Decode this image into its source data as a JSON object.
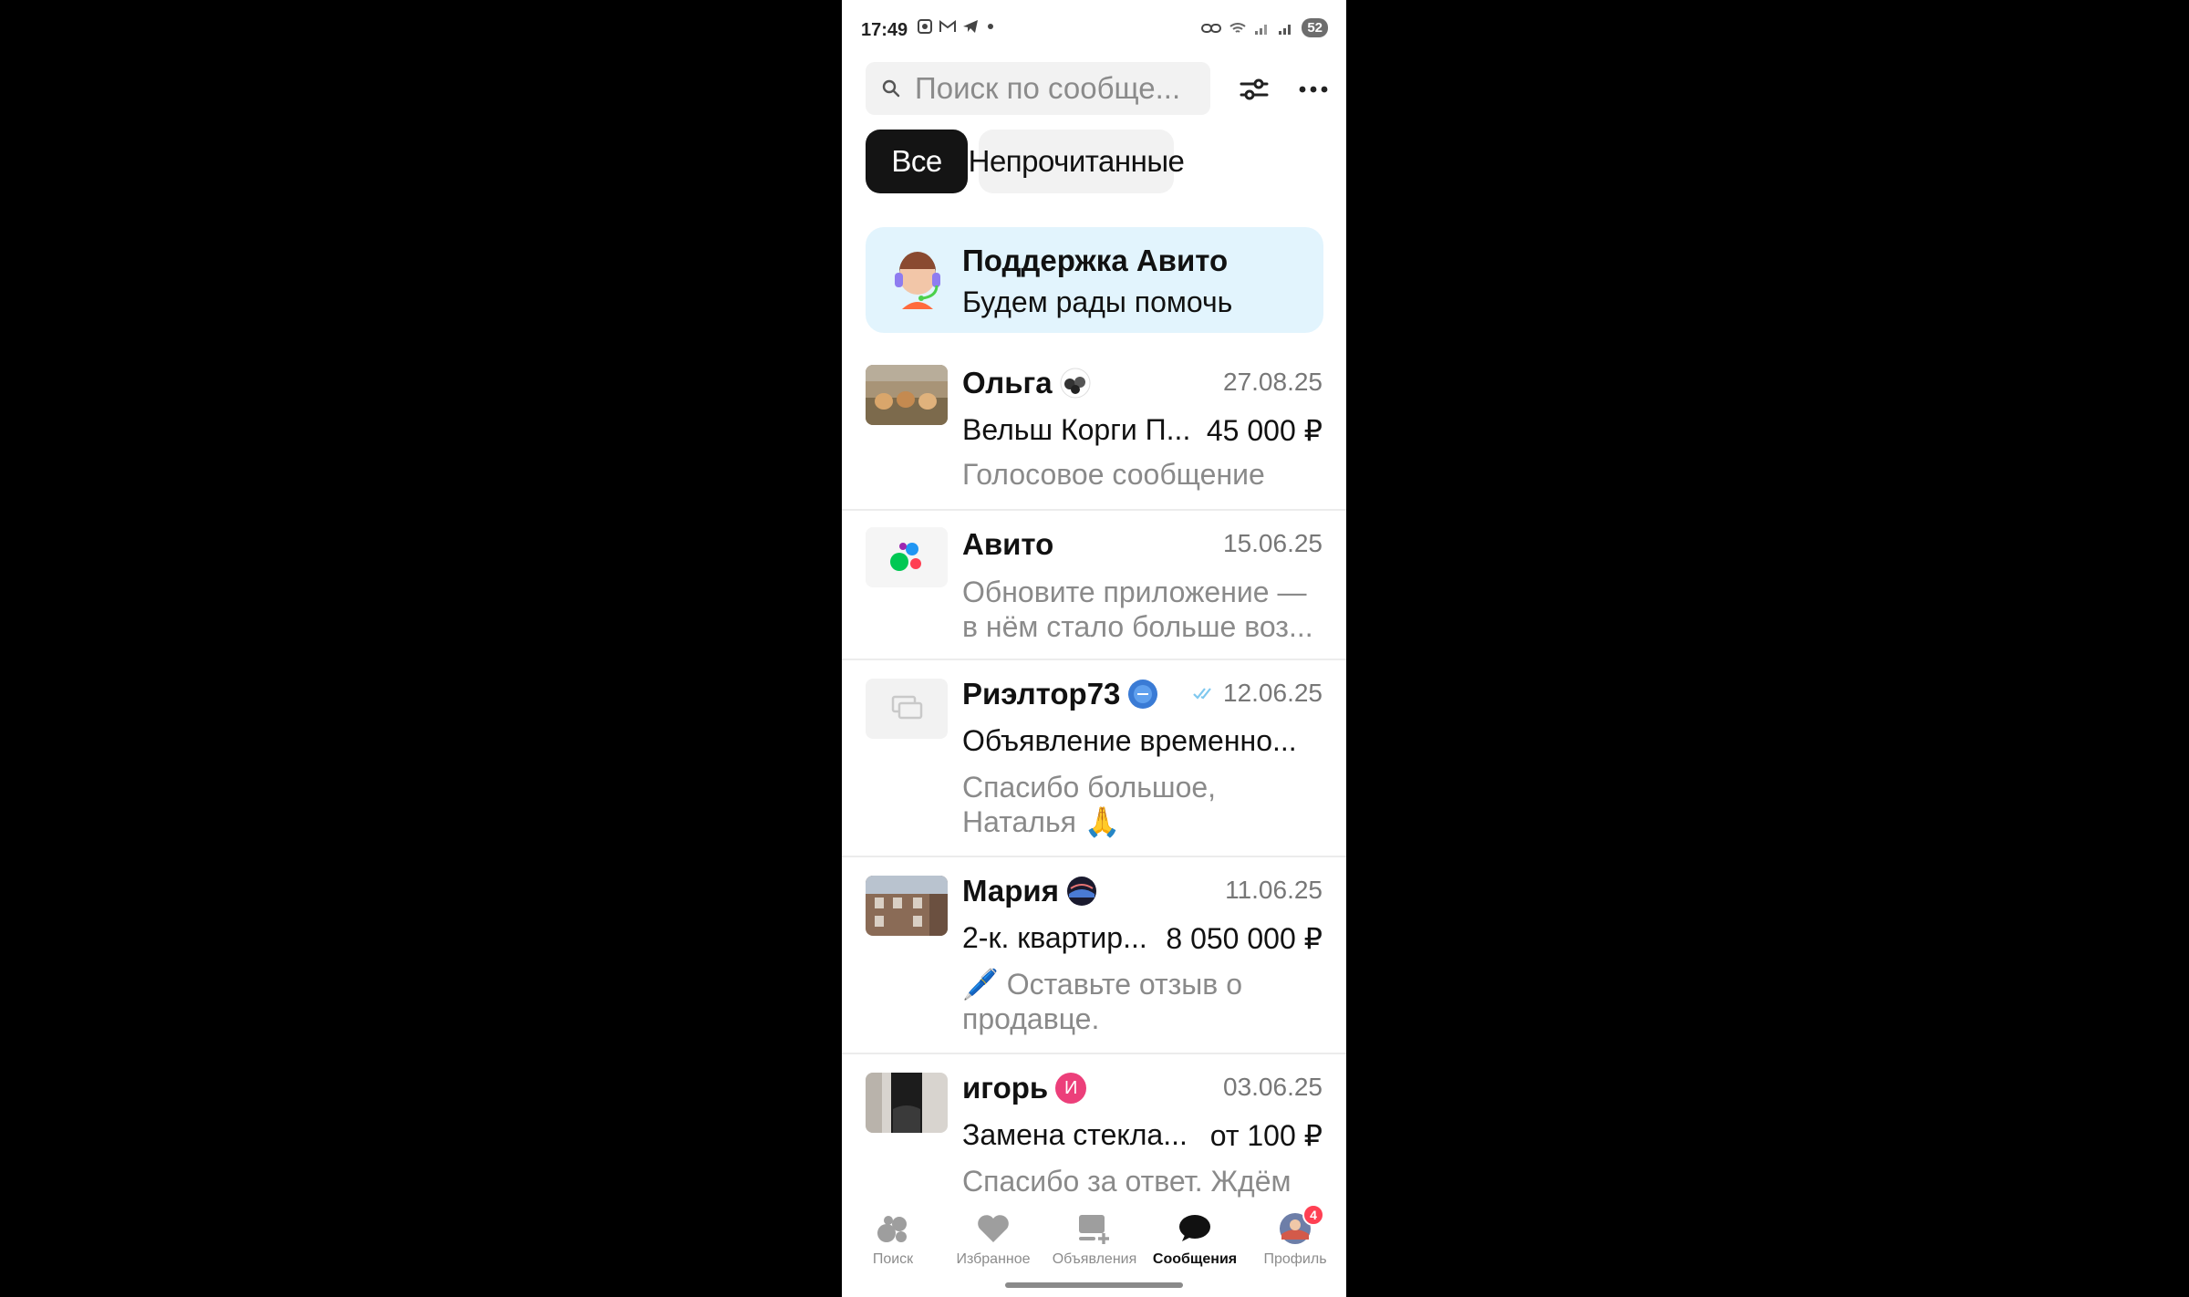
{
  "status_bar": {
    "time": "17:49",
    "battery": "52",
    "left_icons": [
      "screenshot-icon",
      "gmail-icon",
      "telegram-icon",
      "dot-icon"
    ],
    "right_icons": [
      "link-icon",
      "wifi-icon",
      "signal-icon",
      "signal-icon"
    ]
  },
  "search": {
    "placeholder": "Поиск по сообще..."
  },
  "toolbar": {
    "filter_icon": "sliders-icon",
    "more_icon": "more-dots-icon"
  },
  "chips": {
    "all": "Все",
    "unread": "Непрочитанные"
  },
  "support": {
    "title": "Поддержка Авито",
    "subtitle": "Будем рады помочь"
  },
  "chats": [
    {
      "name": "Ольга",
      "date": "27.08.25",
      "item": "Вельш Корги П...",
      "price": "45 000 ₽",
      "message": "Голосовое сообщение"
    },
    {
      "name": "Авито",
      "date": "15.06.25",
      "message": "Обновите приложение — в нём стало больше воз..."
    },
    {
      "name": "Риэлтор73",
      "date": "12.06.25",
      "item": "Объявление временно...",
      "message": "Спасибо большое, Наталья 🙏"
    },
    {
      "name": "Мария",
      "date": "11.06.25",
      "item": "2-к. квартир...",
      "price": "8 050 000 ₽",
      "message": "🖊️ Оставьте отзыв о продавце."
    },
    {
      "name": "игорь",
      "avatar_letter": "И",
      "date": "03.06.25",
      "item": "Замена стекла...",
      "price": "от 100 ₽",
      "message": "Спасибо за ответ. Ждём"
    }
  ],
  "nav": {
    "search": "Поиск",
    "favorites": "Избранное",
    "ads": "Объявления",
    "messages": "Сообщения",
    "profile": "Профиль",
    "profile_badge": "4"
  },
  "colors": {
    "accent_dark": "#141414",
    "support_bg": "#e2f4fd",
    "badge_red": "#ff4053",
    "muted_text": "#8a8a8a"
  }
}
